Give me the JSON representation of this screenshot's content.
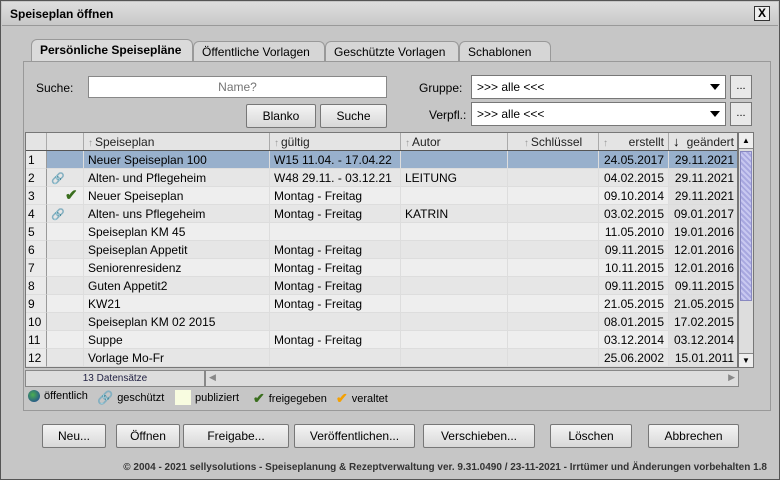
{
  "window": {
    "title": "Speiseplan öffnen",
    "close": "X"
  },
  "tabs": [
    {
      "label": "Persönliche Speisepläne",
      "active": true
    },
    {
      "label": "Öffentliche Vorlagen"
    },
    {
      "label": "Geschützte Vorlagen"
    },
    {
      "label": "Schablonen"
    }
  ],
  "search": {
    "label": "Suche:",
    "placeholder": "Name?",
    "value": "",
    "blanko": "Blanko",
    "suche": "Suche"
  },
  "filters": {
    "gruppe_label": "Gruppe:",
    "gruppe_value": ">>> alle <<<",
    "verpfl_label": "Verpfl.:",
    "verpfl_value": ">>> alle <<<",
    "more": "..."
  },
  "table": {
    "columns": [
      "",
      "",
      "Speiseplan",
      "gültig",
      "Autor",
      "Schlüssel",
      "erstellt",
      "geändert"
    ],
    "rows": [
      [
        "1",
        "",
        "Neuer Speiseplan 100",
        "W15 11.04. - 17.04.22",
        "",
        "",
        "24.05.2017",
        "29.11.2021"
      ],
      [
        "2",
        "chain",
        "Alten- und Pflegeheim",
        "W48 29.11. - 03.12.21",
        "LEITUNG",
        "",
        "04.02.2015",
        "29.11.2021"
      ],
      [
        "3",
        "check",
        "Neuer Speiseplan",
        "Montag - Freitag",
        "",
        "",
        "09.10.2014",
        "29.11.2021"
      ],
      [
        "4",
        "chain",
        "Alten- uns Pflegeheim",
        "Montag - Freitag",
        "KATRIN",
        "",
        "03.02.2015",
        "09.01.2017"
      ],
      [
        "5",
        "",
        "Speiseplan KM 45",
        "",
        "",
        "",
        "11.05.2010",
        "19.01.2016"
      ],
      [
        "6",
        "",
        "Speiseplan Appetit",
        "Montag - Freitag",
        "",
        "",
        "09.11.2015",
        "12.01.2016"
      ],
      [
        "7",
        "",
        "Seniorenresidenz",
        "Montag - Freitag",
        "",
        "",
        "10.11.2015",
        "12.01.2016"
      ],
      [
        "8",
        "",
        "Guten Appetit2",
        "Montag - Freitag",
        "",
        "",
        "09.11.2015",
        "09.11.2015"
      ],
      [
        "9",
        "",
        "KW21",
        "Montag - Freitag",
        "",
        "",
        "21.05.2015",
        "21.05.2015"
      ],
      [
        "10",
        "",
        "Speiseplan KM 02 2015",
        "",
        "",
        "",
        "08.01.2015",
        "17.02.2015"
      ],
      [
        "11",
        "",
        "Suppe",
        "Montag - Freitag",
        "",
        "",
        "03.12.2014",
        "03.12.2014"
      ],
      [
        "12",
        "",
        "Vorlage Mo-Fr",
        "",
        "",
        "",
        "25.06.2002",
        "15.01.2011"
      ]
    ],
    "selected_row": 0,
    "count": "13 Datensätze"
  },
  "legend": {
    "public": "öffentlich",
    "protected": "geschützt",
    "published": "publiziert",
    "released": "freigegeben",
    "outdated": "veraltet"
  },
  "colors": {
    "selected": "#98b0cc",
    "check_green": "#3a6e1e",
    "check_orange": "#f5a000",
    "published_bg": "#f8fce0"
  },
  "buttons": [
    "Neu...",
    "Öffnen",
    "Freigabe...",
    "Veröffentlichen...",
    "Verschieben...",
    "Löschen",
    "Abbrechen"
  ],
  "footer": "© 2004 - 2021 sellysolutions - Speiseplanung & Rezeptverwaltung ver. 9.31.0490 / 23-11-2021 - Irrtümer und Änderungen vorbehalten  1.8"
}
